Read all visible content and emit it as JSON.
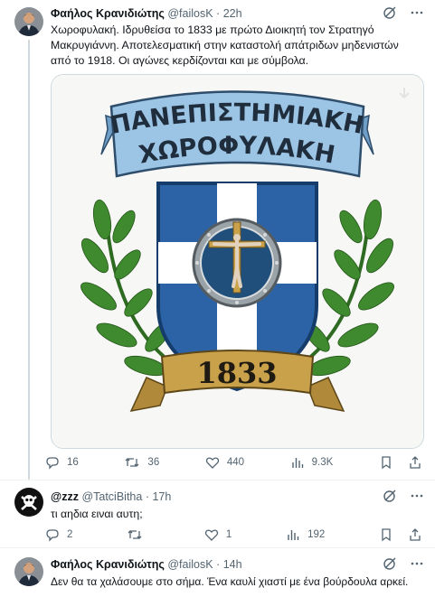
{
  "tweet1": {
    "author": "Φαήλος Κρανιδιώτης",
    "handle": "@failosK",
    "time": "22h",
    "text": "Χωροφυλακή. Ιδρυθείσα το 1833 με πρώτο Διοικητή τον Στρατηγό Μακρυγιάννη. Αποτελεσματική στην καταστολή απάτριδων μηδενιστών από το 1918. Οι αγώνες κερδίζονται και με σύμβολα.",
    "image": {
      "banner_line1": "ΠΑΝΕΠΙΣΤΗΜΙΑΚΗ",
      "banner_line2": "ΧΩΡΟΦΥΛΑΚΗ",
      "year": "1833",
      "shield_color": "#2b63a6",
      "ribbon_color": "#9cc4e4",
      "gold_color": "#c9a14a",
      "laurel_color": "#3f8a2e"
    },
    "stats": {
      "replies": "16",
      "retweets": "36",
      "likes": "440",
      "views": "9.3K"
    }
  },
  "reply1": {
    "author": "@zzz",
    "handle": "@TatciBitha",
    "time": "17h",
    "text": "τι αηδια ειναι αυτη;",
    "stats": {
      "replies": "2",
      "retweets": "",
      "likes": "1",
      "views": "192"
    }
  },
  "tweet3": {
    "author": "Φαήλος Κρανιδιώτης",
    "handle": "@failosK",
    "time": "14h",
    "text": "Δεν θα τα χαλάσουμε στο σήμα. Ένα καυλί χιαστί με ένα βούρδουλα αρκεί."
  },
  "icons": {
    "grok": "grok-icon",
    "more": "more-icon",
    "reply": "reply-icon",
    "retweet": "retweet-icon",
    "like": "like-icon",
    "views": "views-icon",
    "bookmark": "bookmark-icon",
    "share": "share-icon"
  }
}
